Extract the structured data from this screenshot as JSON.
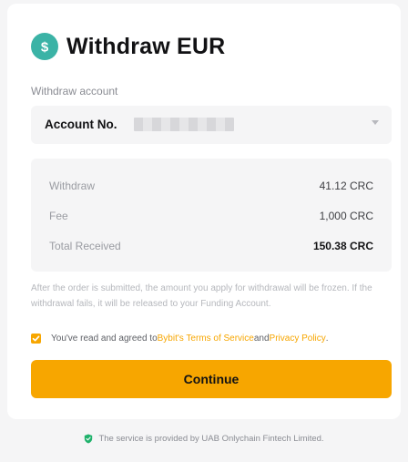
{
  "header": {
    "title": "Withdraw EUR",
    "coin_symbol": "$",
    "coin_icon": "dollar-coin-icon",
    "coin_color": "#3bb3a6"
  },
  "account": {
    "label": "Withdraw account",
    "selected_prefix": "Account No.",
    "masked_value": "••••••••••",
    "dropdown_icon": "chevron-down-icon"
  },
  "summary": {
    "rows": [
      {
        "key": "Withdraw",
        "value": "41.12 CRC"
      },
      {
        "key": "Fee",
        "value": "1,000 CRC"
      },
      {
        "key": "Total Received",
        "value": "150.38 CRC"
      }
    ]
  },
  "notice": "After the order is submitted, the amount you apply for withdrawal will be frozen. If the withdrawal fails, it will be released to your Funding Account.",
  "agreement": {
    "checked": true,
    "prefix": "You've read and agreed to ",
    "terms_link": "Bybit's Terms of Service",
    "and": " and ",
    "privacy_link": "Privacy Policy",
    "suffix": "."
  },
  "actions": {
    "continue_label": "Continue"
  },
  "footer": {
    "text": "The service is provided by UAB Onlychain Fintech Limited.",
    "icon": "shield-check-icon",
    "icon_color": "#20b26c"
  },
  "colors": {
    "accent": "#f7a600",
    "background": "#f5f5f6",
    "card": "#ffffff"
  }
}
